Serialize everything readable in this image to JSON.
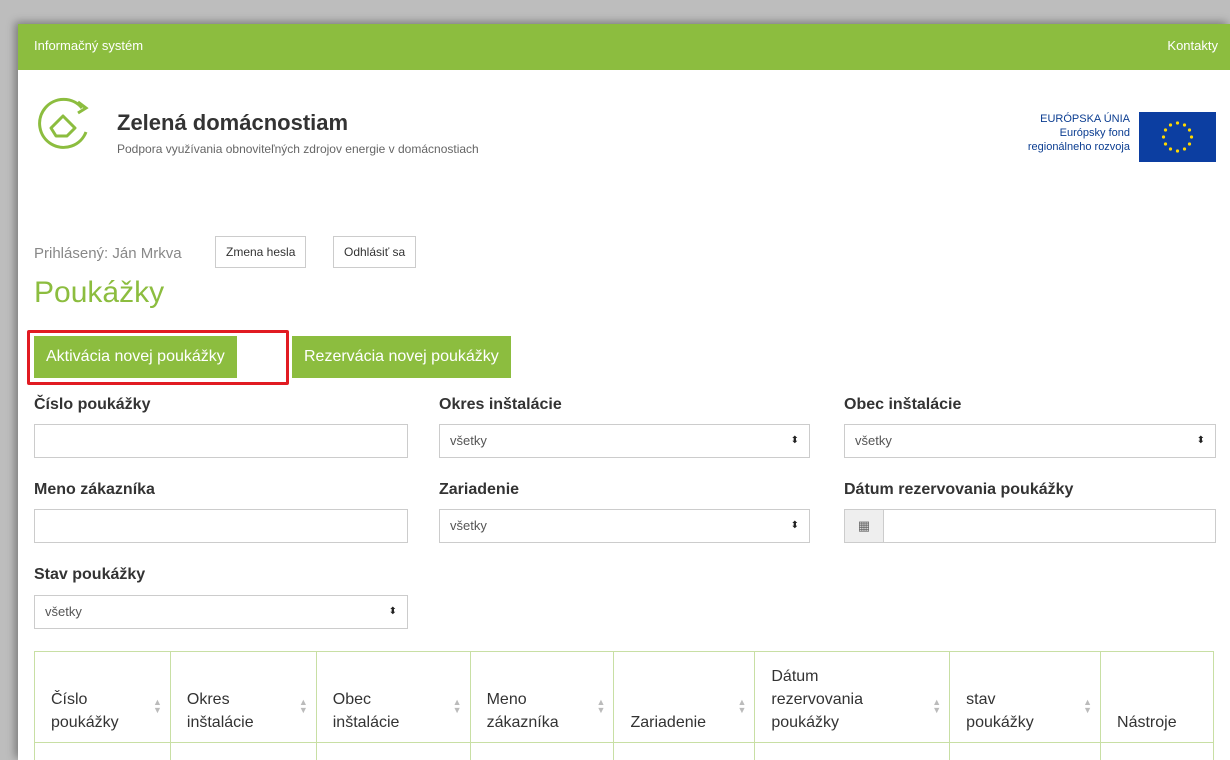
{
  "topbar": {
    "left": "Informačný systém",
    "right": "Kontakty"
  },
  "brand": {
    "title": "Zelená domácnostiam",
    "subtitle": "Podpora využívania obnoviteľných zdrojov energie v domácnostiach",
    "logo_icon": "house-arrow-logo-icon"
  },
  "eu": {
    "line1": "EURÓPSKA ÚNIA",
    "line2": "Európsky fond",
    "line3": "regionálneho rozvoja",
    "flag_icon": "eu-flag-icon"
  },
  "user": {
    "logged_in_text": "Prihlásený: Ján Mrkva",
    "change_password": "Zmena hesla",
    "logout": "Odhlásiť sa"
  },
  "page": {
    "title": "Poukážky"
  },
  "actions": {
    "activate": "Aktivácia novej poukážky",
    "reserve": "Rezervácia novej poukážky"
  },
  "filters": {
    "voucher_number": {
      "label": "Číslo poukážky",
      "value": ""
    },
    "district": {
      "label": "Okres inštalácie",
      "value": "všetky"
    },
    "municipality": {
      "label": "Obec inštalácie",
      "value": "všetky"
    },
    "customer_name": {
      "label": "Meno zákazníka",
      "value": ""
    },
    "device": {
      "label": "Zariadenie",
      "value": "všetky"
    },
    "reservation_date": {
      "label": "Dátum rezervovania poukážky",
      "value": ""
    },
    "status": {
      "label": "Stav poukážky",
      "value": "všetky"
    }
  },
  "table": {
    "headers": [
      {
        "line1": "Číslo",
        "line2": "poukážky"
      },
      {
        "line1": "Okres",
        "line2": "inštalácie"
      },
      {
        "line1": "Obec",
        "line2": "inštalácie"
      },
      {
        "line1": "Meno",
        "line2": "zákazníka"
      },
      {
        "line1": "",
        "line2": "Zariadenie"
      },
      {
        "line1": "Dátum",
        "line2": "rezervovania",
        "line3": "poukážky"
      },
      {
        "line1": "stav",
        "line2": "poukážky"
      },
      {
        "line1": "",
        "line2": "Nástroje"
      }
    ]
  },
  "colors": {
    "brand_green": "#8cbd3f",
    "highlight_red": "#e11b22",
    "eu_blue": "#0c3ea1"
  }
}
